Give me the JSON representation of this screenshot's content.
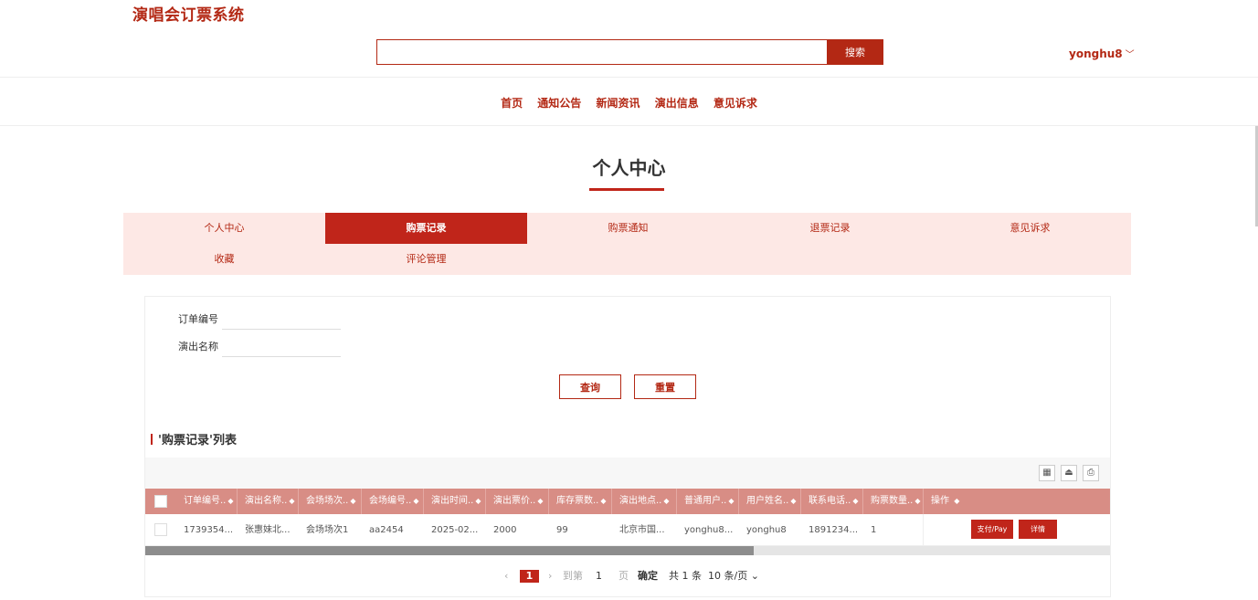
{
  "app": {
    "brand": "演唱会订票系统"
  },
  "search": {
    "placeholder": "",
    "button": "搜索"
  },
  "user": {
    "name": "yonghu8"
  },
  "nav": {
    "items": [
      "首页",
      "通知公告",
      "新闻资讯",
      "演出信息",
      "意见诉求"
    ]
  },
  "page": {
    "title": "个人中心"
  },
  "tabs": [
    "个人中心",
    "购票记录",
    "购票通知",
    "退票记录",
    "意见诉求",
    "收藏",
    "评论管理"
  ],
  "form": {
    "order_no_label": "订单编号",
    "show_name_label": "演出名称",
    "query_button": "查询",
    "reset_button": "重置"
  },
  "list": {
    "title": "'购票记录'列表",
    "columns": [
      "订单编号..",
      "演出名称..",
      "会场场次..",
      "会场编号..",
      "演出时间..",
      "演出票价..",
      "库存票数..",
      "演出地点..",
      "普通用户..",
      "用户姓名..",
      "联系电话..",
      "购票数量..",
      "操作"
    ],
    "rows": [
      [
        "1739354...",
        "张惠妹北...",
        "会场场次1",
        "aa2454",
        "2025-02...",
        "2000",
        "99",
        "北京市国...",
        "yonghu8...",
        "yonghu8",
        "1891234...",
        "1"
      ]
    ],
    "row_actions": {
      "pay": "支付/Pay",
      "detail": "详情"
    }
  },
  "pagination": {
    "current_page": "1",
    "goto_label": "到第",
    "goto_value": "1",
    "page_unit": "页",
    "confirm": "确定",
    "total": "共 1 条",
    "page_size": "10 条/页"
  }
}
